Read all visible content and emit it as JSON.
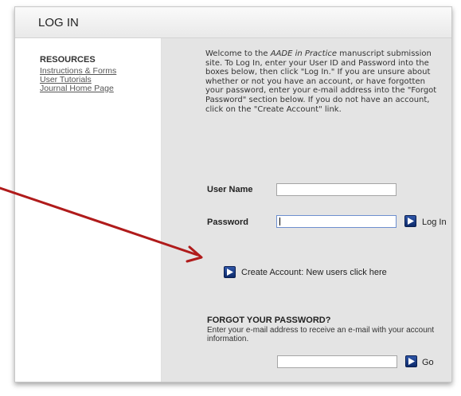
{
  "header": {
    "title": "LOG IN"
  },
  "sidebar": {
    "title": "RESOURCES",
    "links": [
      "Instructions & Forms",
      "User Tutorials",
      "Journal Home Page"
    ]
  },
  "welcome": {
    "part1": "Welcome to the ",
    "journal": "AADE in Practice",
    "part2": " manuscript submission site. To Log In, enter your User ID and Password into the boxes below, then click \"Log In.\" If you are unsure about whether or not you have an account, or have forgotten your password, enter your e-mail address into the \"Forgot Password\" section below. If you do not have an account, click on the \"Create Account\" link."
  },
  "login": {
    "username_label": "User Name",
    "username_value": "",
    "password_label": "Password",
    "password_value": "",
    "login_label": "Log In"
  },
  "create_account": {
    "label": "Create Account: New users click here"
  },
  "forgot": {
    "title": "FORGOT YOUR PASSWORD?",
    "description": "Enter your e-mail address to receive an e-mail with your account information.",
    "email_value": "",
    "go_label": "Go"
  },
  "colors": {
    "annotation_arrow": "#b01b1b",
    "button_blue": "#1f418f",
    "main_bg": "#e4e4e4"
  },
  "icons": {
    "play": "play-icon",
    "arrow": "annotation-arrow"
  }
}
